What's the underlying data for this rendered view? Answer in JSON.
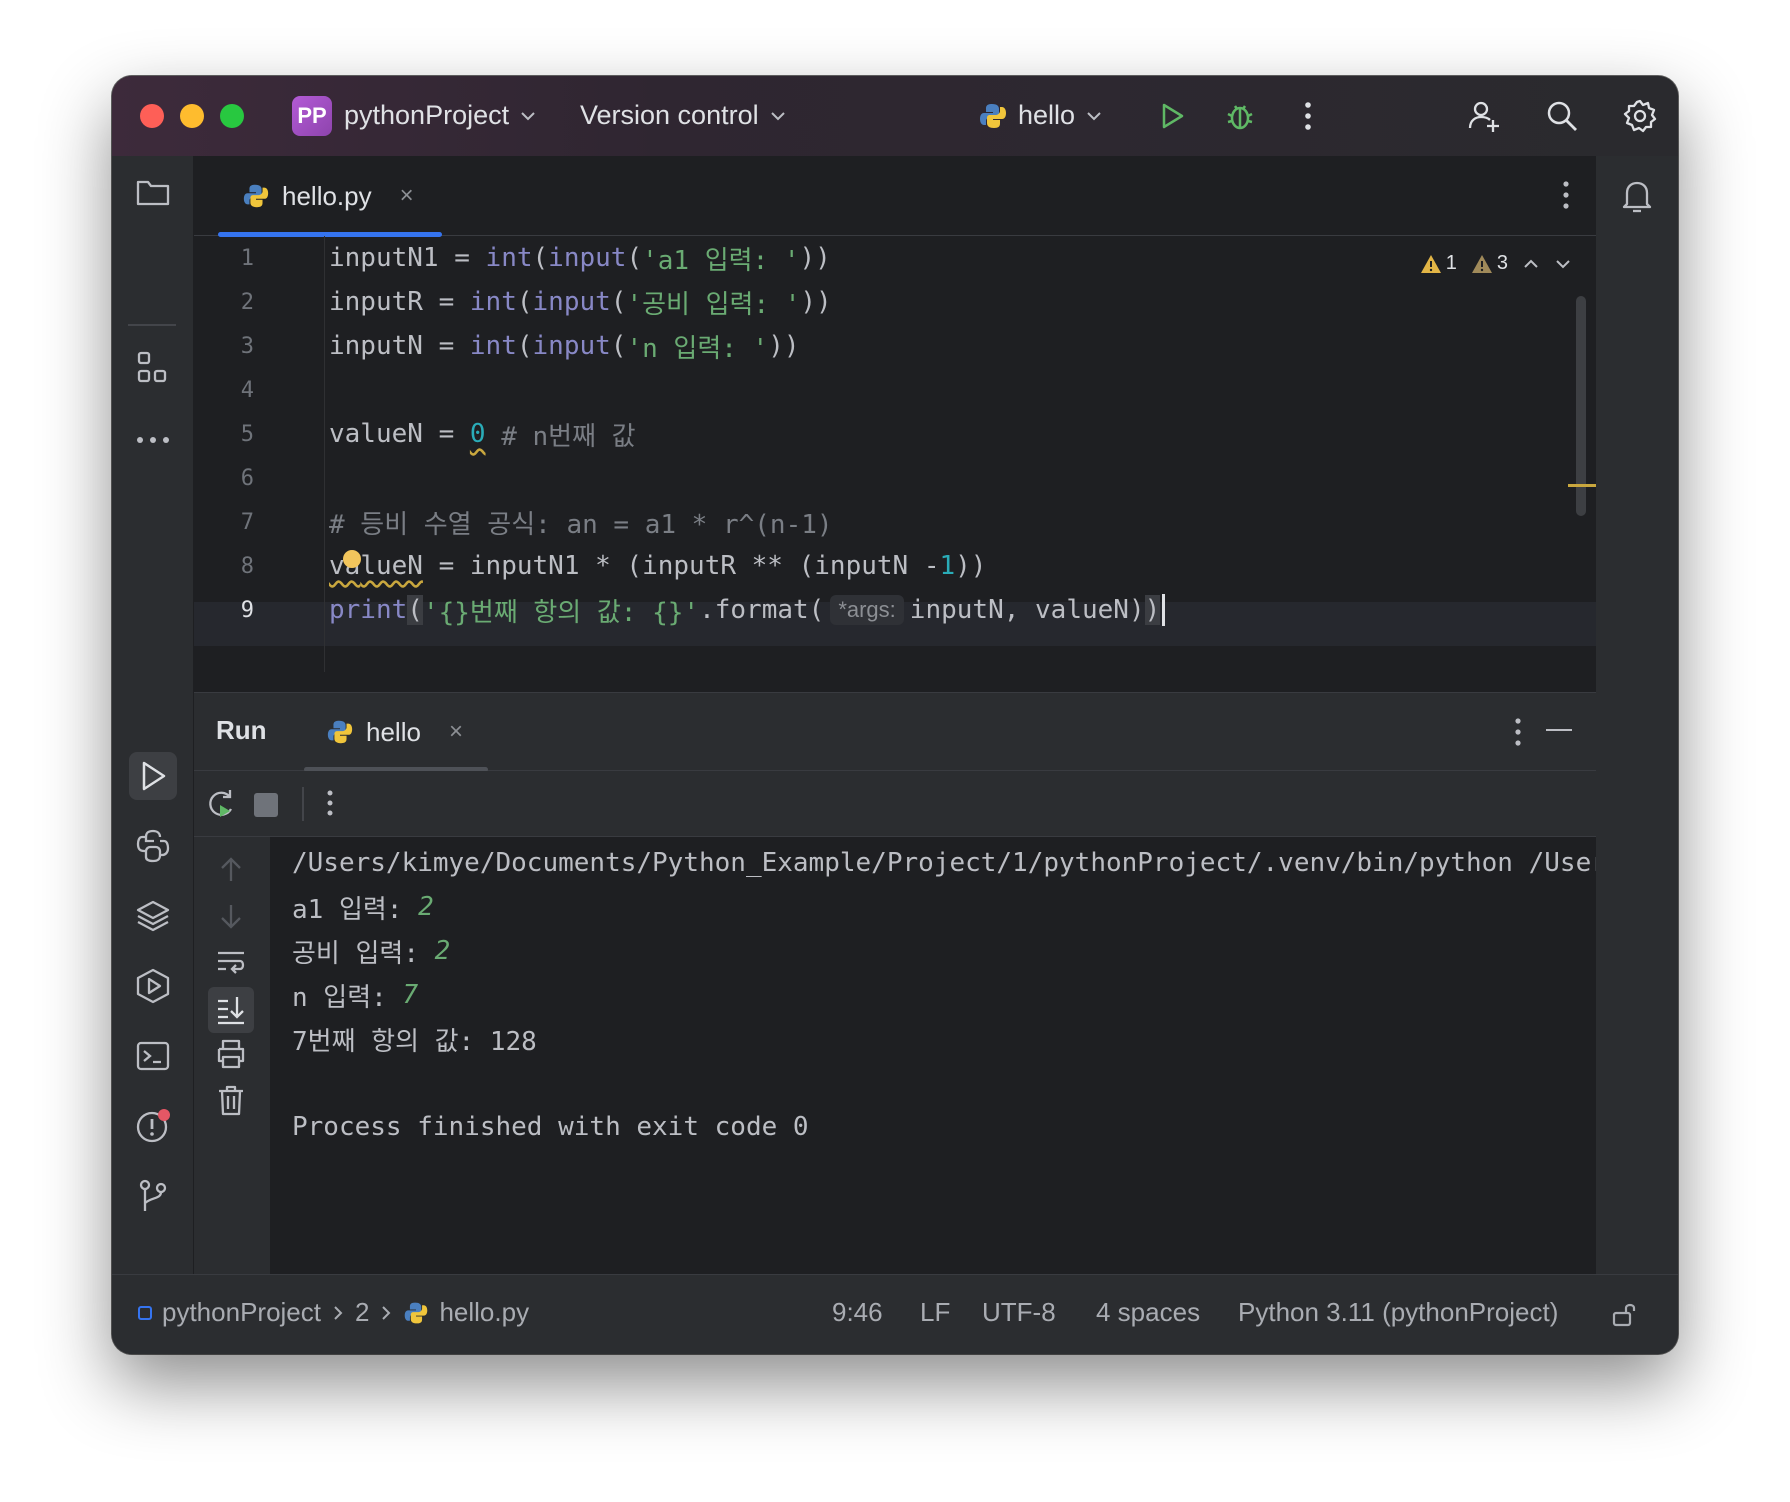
{
  "titlebar": {
    "project_badge": "PP",
    "project_name": "pythonProject",
    "vcs_label": "Version control",
    "run_config": "hello"
  },
  "editor": {
    "tab_label": "hello.py",
    "tab_close": "×",
    "inspections": {
      "errors": "1",
      "warnings": "3"
    },
    "line_numbers": [
      "1",
      "2",
      "3",
      "4",
      "5",
      "6",
      "7",
      "8",
      "9"
    ],
    "lines": {
      "l1": {
        "var": "inputN1 = ",
        "int": "int",
        "p1": "(",
        "input": "input",
        "p2": "(",
        "str": "'a1 입력: '",
        "p3": "))"
      },
      "l2": {
        "var": "inputR = ",
        "int": "int",
        "p1": "(",
        "input": "input",
        "p2": "(",
        "str": "'공비 입력: '",
        "p3": "))"
      },
      "l3": {
        "var": "inputN = ",
        "int": "int",
        "p1": "(",
        "input": "input",
        "p2": "(",
        "str": "'n 입력: '",
        "p3": "))"
      },
      "l5": {
        "var": "valueN = ",
        "num": "0",
        "cmt": " # n번째 값"
      },
      "l7": {
        "cmt": "# 등비 수열 공식: an = a1 * r^(n-1)"
      },
      "l8": {
        "v1": "va",
        "v2": "lueN",
        "rest": " = inputN1 * (inputR ** (inputN -",
        "num": "1",
        "end": "))"
      },
      "l9": {
        "print": "print",
        "p1": "(",
        "str": "'{}번째 항의 값: {}'",
        "fmt": ".format(",
        "hint": "*args:",
        "args": "inputN, valueN)",
        "close": ")"
      }
    }
  },
  "run": {
    "title": "Run",
    "tab_label": "hello",
    "tab_close": "×",
    "console": {
      "cmd": "/Users/kimye/Documents/Python_Example/Project/1/pythonProject/.venv/bin/python /Users/kimye/Documents/Python_Example/Project/1/pythonProject/hello.py",
      "p1": "a1 입력: ",
      "v1": "2",
      "p2": "공비 입력: ",
      "v2": "2",
      "p3": "n 입력: ",
      "v3": "7",
      "result": "7번째 항의 값: 128",
      "exit": "Process finished with exit code 0"
    }
  },
  "statusbar": {
    "crumb_project": "pythonProject",
    "crumb_folder": "2",
    "crumb_file": "hello.py",
    "position": "9:46",
    "line_sep": "LF",
    "encoding": "UTF-8",
    "indent": "4 spaces",
    "interpreter": "Python 3.11 (pythonProject)"
  },
  "colors": {
    "accent": "#3574f0",
    "string": "#6aab73",
    "builtin": "#8888c6",
    "number": "#2aacb8",
    "comment": "#7a7e85",
    "warning": "#c9a73e"
  }
}
